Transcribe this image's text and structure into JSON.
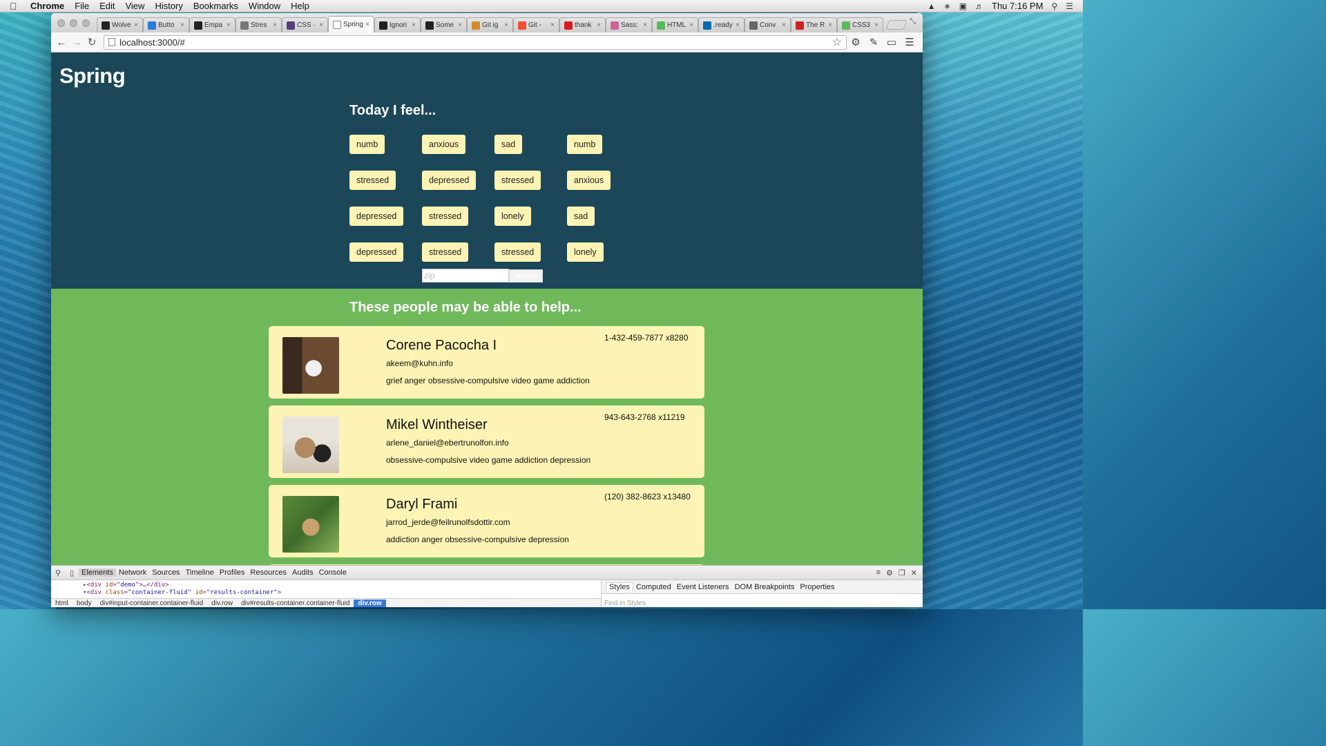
{
  "menubar": {
    "app": "Chrome",
    "menus": [
      "File",
      "Edit",
      "View",
      "History",
      "Bookmarks",
      "Window",
      "Help"
    ],
    "clock": "Thu 7:16 PM"
  },
  "tabs": [
    {
      "label": "Wolve",
      "color": "#222222",
      "icon": "github-icon"
    },
    {
      "label": "Butto",
      "color": "#2b7bd8",
      "icon": "p-icon"
    },
    {
      "label": "Empa",
      "color": "#222222",
      "icon": "site-icon"
    },
    {
      "label": "Stres",
      "color": "#777777",
      "icon": "h-icon"
    },
    {
      "label": "CSS ·",
      "color": "#563d7c",
      "icon": "bootstrap-icon"
    },
    {
      "label": "Spring",
      "color": "#ffffff",
      "icon": "page-icon"
    },
    {
      "label": "Ignori",
      "color": "#222222",
      "icon": "github-icon"
    },
    {
      "label": "Some",
      "color": "#222222",
      "icon": "github-icon"
    },
    {
      "label": "Git ig",
      "color": "#d38b2a",
      "icon": "stack-icon"
    },
    {
      "label": "Git -",
      "color": "#f05133",
      "icon": "git-icon"
    },
    {
      "label": "thank",
      "color": "#d81b1b",
      "icon": "a-icon"
    },
    {
      "label": "Sass:",
      "color": "#cf649a",
      "icon": "sass-icon"
    },
    {
      "label": "HTML",
      "color": "#5cb85c",
      "icon": "w3-icon"
    },
    {
      "label": ".ready",
      "color": "#0769ad",
      "icon": "jquery-icon"
    },
    {
      "label": "Conv",
      "color": "#666666",
      "icon": "globe-icon"
    },
    {
      "label": "The R",
      "color": "#cc2222",
      "icon": "gift-icon"
    },
    {
      "label": "CSS3",
      "color": "#5cb85c",
      "icon": "css3-icon"
    }
  ],
  "address": "localhost:3000/#",
  "page": {
    "brand": "Spring",
    "feel_title": "Today I feel...",
    "feelings": [
      [
        "numb",
        "anxious",
        "sad",
        "numb"
      ],
      [
        "stressed",
        "depressed",
        "stressed",
        "anxious"
      ],
      [
        "depressed",
        "stressed",
        "lonely",
        "sad"
      ],
      [
        "depressed",
        "stressed",
        "stressed",
        "lonely"
      ]
    ],
    "zip_placeholder": "zip",
    "search_label": "Search",
    "help_title": "These people may be able to help...",
    "people": [
      {
        "name": "Corene Pacocha I",
        "email": "akeem@kuhn.info",
        "tags": "grief anger obsessive-compulsive video game addiction",
        "phone": "1-432-459-7877 x8280",
        "photo": "cat-photo-1"
      },
      {
        "name": "Mikel Wintheiser",
        "email": "arlene_daniel@ebertrunolfon.info",
        "tags": "obsessive-compulsive video game addiction depression",
        "phone": "943-643-2768 x11219",
        "photo": "cat-photo-2"
      },
      {
        "name": "Daryl Frami",
        "email": "jarrod_jerde@feilrunolfsdottir.com",
        "tags": "addiction anger obsessive-compulsive depression",
        "phone": "(120) 382-8623 x13480",
        "photo": "cat-photo-3"
      }
    ]
  },
  "devtools": {
    "tabs": [
      "Elements",
      "Network",
      "Sources",
      "Timeline",
      "Profiles",
      "Resources",
      "Audits",
      "Console"
    ],
    "line1": {
      "tag": "div",
      "attr": "id",
      "val": "demo"
    },
    "line2": {
      "tag": "div",
      "attr1": "class",
      "val1": "container-fluid",
      "attr2": "id",
      "val2": "results-container"
    },
    "crumbs": [
      "html",
      "body",
      "div#input-container.container-fluid",
      "div.row",
      "div#results-container.container-fluid",
      "div.row"
    ],
    "side_tabs": [
      "Styles",
      "Computed",
      "Event Listeners",
      "DOM Breakpoints",
      "Properties"
    ],
    "find_placeholder": "Find in Styles"
  }
}
